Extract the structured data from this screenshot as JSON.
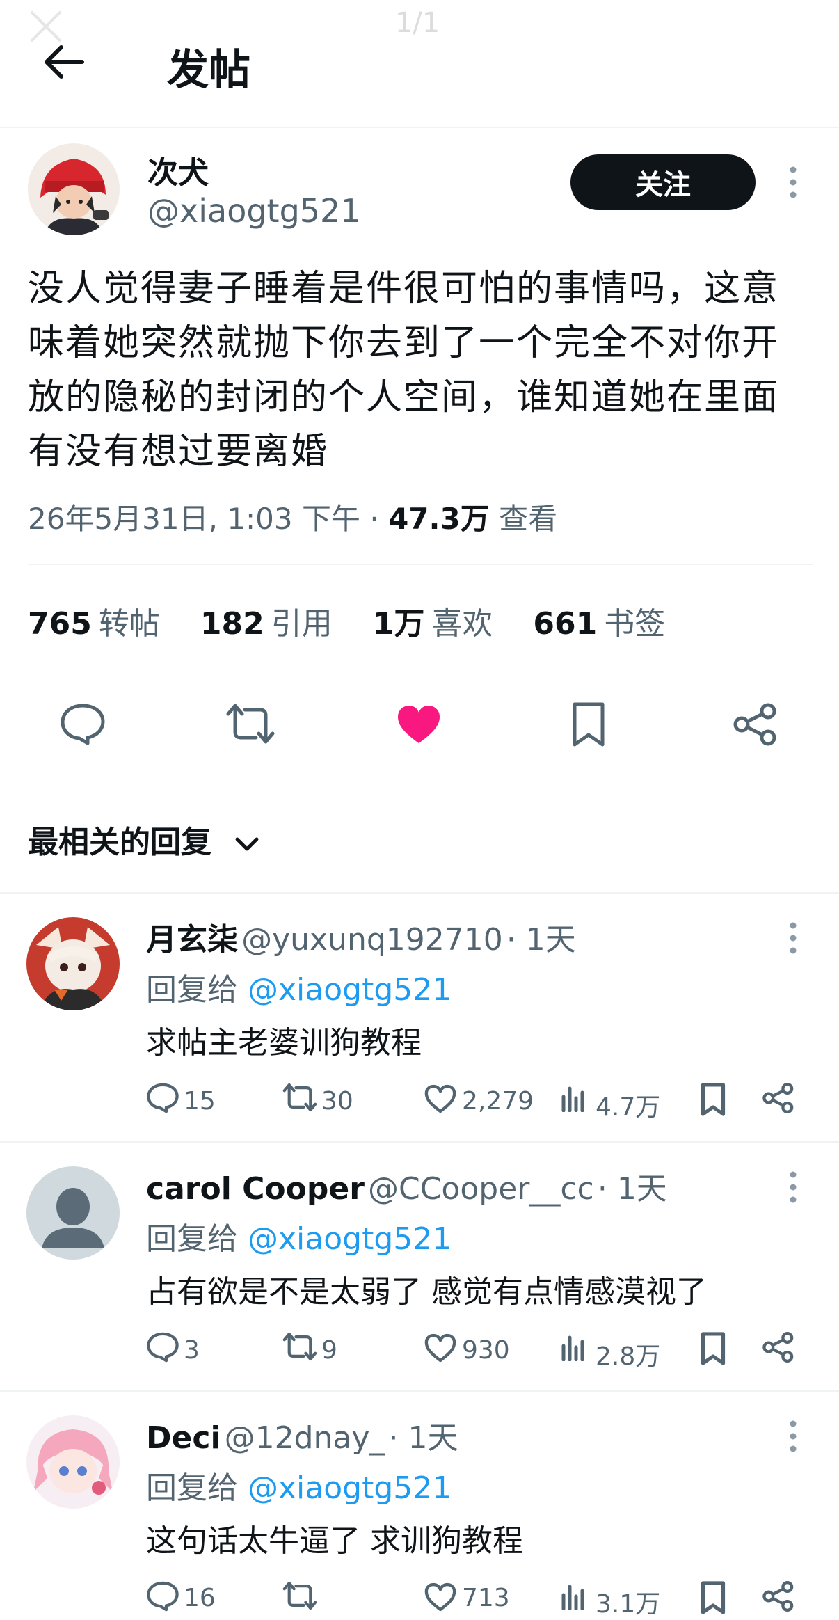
{
  "overlay": {
    "counter": "1/1"
  },
  "header": {
    "title": "发帖"
  },
  "post": {
    "author_name": "次犬",
    "author_handle": "@xiaogtg521",
    "follow_label": "关注",
    "text": "没人觉得妻子睡着是件很可怕的事情吗，这意味着她突然就抛下你去到了一个完全不对你开放的隐秘的封闭的个人空间，谁知道她在里面有没有想过要离婚",
    "timestamp": "26年5月31日, 1:03 下午",
    "separator": "·",
    "views_count": "47.3万",
    "views_label": "查看",
    "stats": [
      {
        "count": "765",
        "label": "转帖"
      },
      {
        "count": "182",
        "label": "引用"
      },
      {
        "count": "1万",
        "label": "喜欢"
      },
      {
        "count": "661",
        "label": "书签"
      }
    ],
    "liked": true,
    "colors": {
      "like": "#f91880",
      "link": "#1d9bf0",
      "text": "#0f1419",
      "secondary": "#536471"
    }
  },
  "replies_section": {
    "title": "最相关的回复"
  },
  "replies": [
    {
      "name": "月玄柒",
      "handle": "@yuxunq192710",
      "time": "· 1天",
      "reply_prefix": "回复给",
      "reply_to": "@xiaogtg521",
      "text": "求帖主老婆训狗教程",
      "replies": "15",
      "reposts": "30",
      "likes": "2,279",
      "views": "4.7万"
    },
    {
      "name": "carol Cooper",
      "handle": "@CCooper__cc",
      "time": "· 1天",
      "reply_prefix": "回复给",
      "reply_to": "@xiaogtg521",
      "text": "占有欲是不是太弱了 感觉有点情感漠视了",
      "replies": "3",
      "reposts": "9",
      "likes": "930",
      "views": "2.8万"
    },
    {
      "name": "Deci",
      "handle": "@12dnay_",
      "time": "· 1天",
      "reply_prefix": "回复给",
      "reply_to": "@xiaogtg521",
      "text": "这句话太牛逼了 求训狗教程",
      "replies": "16",
      "reposts": "",
      "likes": "713",
      "views": "3.1万"
    }
  ]
}
